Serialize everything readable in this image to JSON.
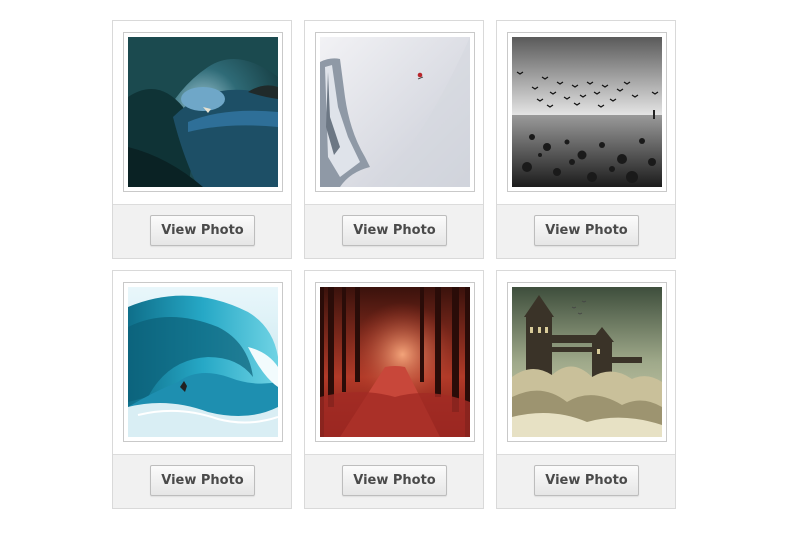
{
  "gallery": {
    "items": [
      {
        "name": "wave-tube-surfer",
        "button_label": "View Photo"
      },
      {
        "name": "snow-slope-skier",
        "button_label": "View Photo"
      },
      {
        "name": "birds-beach",
        "button_label": "View Photo"
      },
      {
        "name": "turquoise-wave",
        "button_label": "View Photo"
      },
      {
        "name": "red-forest-path",
        "button_label": "View Photo"
      },
      {
        "name": "tower-bridge-storm",
        "button_label": "View Photo"
      }
    ]
  }
}
